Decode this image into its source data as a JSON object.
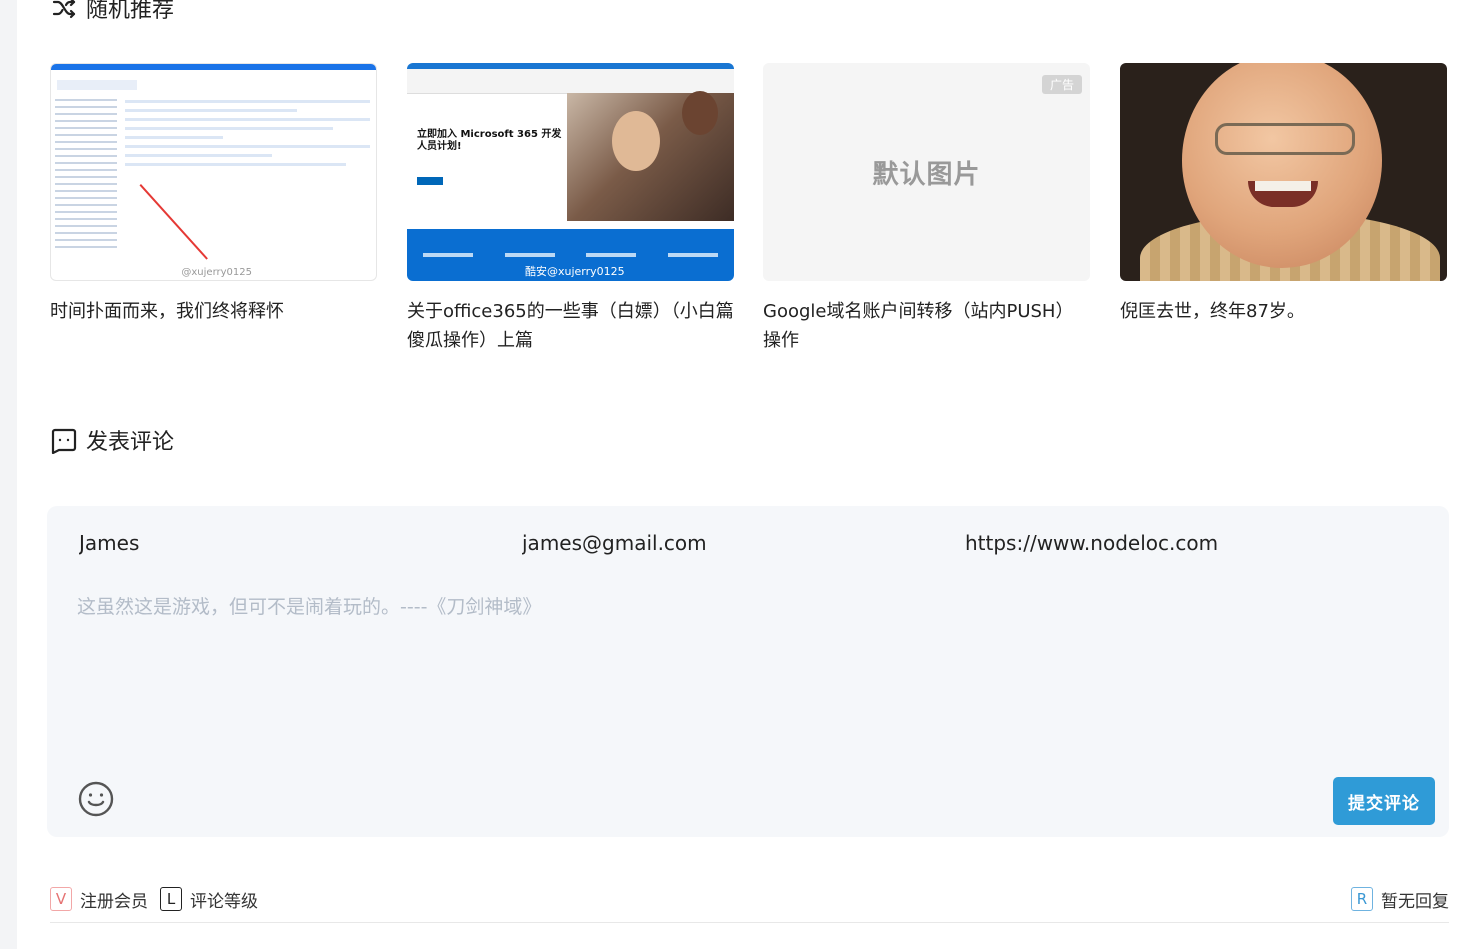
{
  "recommend": {
    "heading": "随机推荐",
    "items": [
      {
        "title": "时间扑面而来，我们终将释怀",
        "thumb_watermark": "@xujerry0125"
      },
      {
        "title": "关于office365的一些事（白嫖）（小白篇傻瓜操作）上篇",
        "thumb_heading": "立即加入 Microsoft 365 开发人员计划!",
        "thumb_watermark": "酷安@xujerry0125"
      },
      {
        "title": "Google域名账户间转移（站内PUSH）操作",
        "thumb_text": "默认图片",
        "ad_badge": "广告"
      },
      {
        "title": "倪匡去世，终年87岁。"
      }
    ]
  },
  "comment": {
    "heading": "发表评论",
    "name_value": "James",
    "email_value": "james@gmail.com",
    "url_value": "https://www.nodeloc.com",
    "content_placeholder": "这虽然这是游戏，但可不是闹着玩的。----《刀剑神域》",
    "submit_label": "提交评论"
  },
  "footer": {
    "register_tag": "V",
    "register_label": "注册会员",
    "level_tag": "L",
    "level_label": "评论等级",
    "reply_tag": "R",
    "reply_label": "暂无回复"
  },
  "colors": {
    "accent": "#2f9bd7",
    "form_bg": "#f5f7fa"
  }
}
